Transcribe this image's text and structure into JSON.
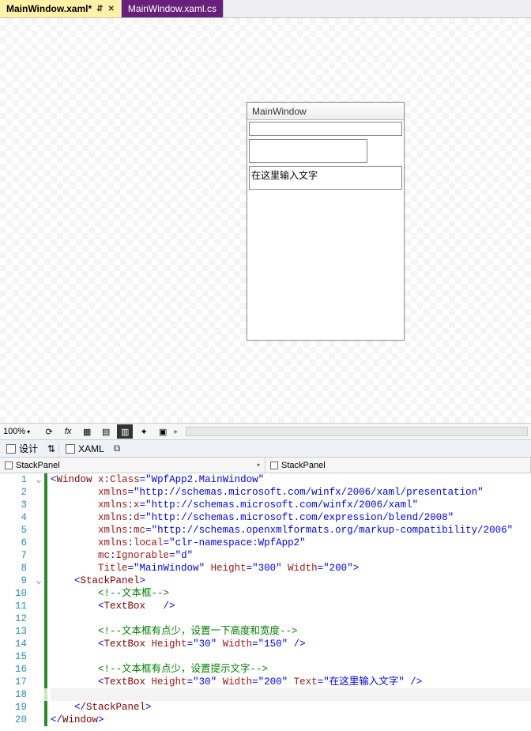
{
  "tabs": {
    "active": {
      "label": "MainWindow.xaml*"
    },
    "inactive": {
      "label": "MainWindow.xaml.cs"
    }
  },
  "preview": {
    "title": "MainWindow",
    "textbox3_text": "在这里输入文字"
  },
  "zoomrow": {
    "zoom_label": "100%",
    "fx": "fx"
  },
  "navrow": {
    "design_label": "设计",
    "xaml_label": "XAML"
  },
  "crumbs": {
    "left": "StackPanel",
    "right": "StackPanel"
  },
  "code": {
    "lines": [
      {
        "n": "1",
        "fold": "v",
        "bar": "bar",
        "seg": [
          [
            "c-blue",
            "<"
          ],
          [
            "c-brown",
            "Window "
          ],
          [
            "c-red",
            "x"
          ],
          [
            "c-blue",
            ":"
          ],
          [
            "c-red",
            "Class"
          ],
          [
            "c-blue",
            "=\""
          ],
          [
            "c-blue",
            "WpfApp2.MainWindow"
          ],
          [
            "c-blue",
            "\""
          ]
        ]
      },
      {
        "n": "2",
        "fold": "",
        "bar": "bar",
        "seg": [
          [
            "sp",
            "        "
          ],
          [
            "c-red",
            "xmlns"
          ],
          [
            "c-blue",
            "=\""
          ],
          [
            "c-blue",
            "http://schemas.microsoft.com/winfx/2006/xaml/presentation"
          ],
          [
            "c-blue",
            "\""
          ]
        ]
      },
      {
        "n": "3",
        "fold": "",
        "bar": "bar",
        "seg": [
          [
            "sp",
            "        "
          ],
          [
            "c-red",
            "xmlns"
          ],
          [
            "c-blue",
            ":"
          ],
          [
            "c-red",
            "x"
          ],
          [
            "c-blue",
            "=\""
          ],
          [
            "c-blue",
            "http://schemas.microsoft.com/winfx/2006/xaml"
          ],
          [
            "c-blue",
            "\""
          ]
        ]
      },
      {
        "n": "4",
        "fold": "",
        "bar": "bar",
        "seg": [
          [
            "sp",
            "        "
          ],
          [
            "c-red",
            "xmlns"
          ],
          [
            "c-blue",
            ":"
          ],
          [
            "c-red",
            "d"
          ],
          [
            "c-blue",
            "=\""
          ],
          [
            "c-blue",
            "http://schemas.microsoft.com/expression/blend/2008"
          ],
          [
            "c-blue",
            "\""
          ]
        ]
      },
      {
        "n": "5",
        "fold": "",
        "bar": "bar",
        "seg": [
          [
            "sp",
            "        "
          ],
          [
            "c-red",
            "xmlns"
          ],
          [
            "c-blue",
            ":"
          ],
          [
            "c-red",
            "mc"
          ],
          [
            "c-blue",
            "=\""
          ],
          [
            "c-blue",
            "http://schemas.openxmlformats.org/markup-compatibility/2006"
          ],
          [
            "c-blue",
            "\""
          ]
        ]
      },
      {
        "n": "6",
        "fold": "",
        "bar": "bar",
        "seg": [
          [
            "sp",
            "        "
          ],
          [
            "c-red",
            "xmlns"
          ],
          [
            "c-blue",
            ":"
          ],
          [
            "c-red",
            "local"
          ],
          [
            "c-blue",
            "=\""
          ],
          [
            "c-blue",
            "clr-namespace:WpfApp2"
          ],
          [
            "c-blue",
            "\""
          ]
        ]
      },
      {
        "n": "7",
        "fold": "",
        "bar": "bar",
        "seg": [
          [
            "sp",
            "        "
          ],
          [
            "c-red",
            "mc"
          ],
          [
            "c-blue",
            ":"
          ],
          [
            "c-red",
            "Ignorable"
          ],
          [
            "c-blue",
            "=\""
          ],
          [
            "c-blue",
            "d"
          ],
          [
            "c-blue",
            "\""
          ]
        ]
      },
      {
        "n": "8",
        "fold": "",
        "bar": "bar",
        "seg": [
          [
            "sp",
            "        "
          ],
          [
            "c-red",
            "Title"
          ],
          [
            "c-blue",
            "=\""
          ],
          [
            "c-blue",
            "MainWindow"
          ],
          [
            "c-blue",
            "\" "
          ],
          [
            "c-red",
            "Height"
          ],
          [
            "c-blue",
            "=\""
          ],
          [
            "c-blue",
            "300"
          ],
          [
            "c-blue",
            "\" "
          ],
          [
            "c-red",
            "Width"
          ],
          [
            "c-blue",
            "=\""
          ],
          [
            "c-blue",
            "200"
          ],
          [
            "c-blue",
            "\">"
          ]
        ]
      },
      {
        "n": "9",
        "fold": "v",
        "bar": "bar",
        "seg": [
          [
            "sp",
            "    "
          ],
          [
            "c-blue",
            "<"
          ],
          [
            "c-brown",
            "StackPanel"
          ],
          [
            "c-blue",
            ">"
          ]
        ]
      },
      {
        "n": "10",
        "fold": "",
        "bar": "bar",
        "seg": [
          [
            "sp",
            "        "
          ],
          [
            "c-green",
            "<!--文本框-->"
          ]
        ]
      },
      {
        "n": "11",
        "fold": "",
        "bar": "bar",
        "seg": [
          [
            "sp",
            "        "
          ],
          [
            "c-blue",
            "<"
          ],
          [
            "c-brown",
            "TextBox   "
          ],
          [
            "c-blue",
            "/>"
          ]
        ]
      },
      {
        "n": "12",
        "fold": "",
        "bar": "bar",
        "seg": [
          [
            "sp",
            ""
          ]
        ]
      },
      {
        "n": "13",
        "fold": "",
        "bar": "bar",
        "seg": [
          [
            "sp",
            "        "
          ],
          [
            "c-green",
            "<!--文本框有点少，设置一下高度和宽度-->"
          ]
        ]
      },
      {
        "n": "14",
        "fold": "",
        "bar": "bar",
        "seg": [
          [
            "sp",
            "        "
          ],
          [
            "c-blue",
            "<"
          ],
          [
            "c-brown",
            "TextBox "
          ],
          [
            "c-red",
            "Height"
          ],
          [
            "c-blue",
            "=\""
          ],
          [
            "c-blue",
            "30"
          ],
          [
            "c-blue",
            "\" "
          ],
          [
            "c-red",
            "Width"
          ],
          [
            "c-blue",
            "=\""
          ],
          [
            "c-blue",
            "150"
          ],
          [
            "c-blue",
            "\" />"
          ]
        ]
      },
      {
        "n": "15",
        "fold": "",
        "bar": "bar",
        "seg": [
          [
            "sp",
            ""
          ]
        ]
      },
      {
        "n": "16",
        "fold": "",
        "bar": "bar",
        "seg": [
          [
            "sp",
            "        "
          ],
          [
            "c-green",
            "<!--文本框有点少，设置提示文字-->"
          ]
        ]
      },
      {
        "n": "17",
        "fold": "",
        "bar": "bar",
        "seg": [
          [
            "sp",
            "        "
          ],
          [
            "c-blue",
            "<"
          ],
          [
            "c-brown",
            "TextBox "
          ],
          [
            "c-red",
            "Height"
          ],
          [
            "c-blue",
            "=\""
          ],
          [
            "c-blue",
            "30"
          ],
          [
            "c-blue",
            "\" "
          ],
          [
            "c-red",
            "Width"
          ],
          [
            "c-blue",
            "=\""
          ],
          [
            "c-blue",
            "200"
          ],
          [
            "c-blue",
            "\" "
          ],
          [
            "c-red",
            "Text"
          ],
          [
            "c-blue",
            "=\""
          ],
          [
            "c-blue",
            "在这里输入文字"
          ],
          [
            "c-blue",
            "\" />"
          ]
        ]
      },
      {
        "n": "18",
        "fold": "",
        "bar": "light",
        "seg": [
          [
            "sp",
            ""
          ]
        ],
        "current": true
      },
      {
        "n": "19",
        "fold": "",
        "bar": "bar",
        "seg": [
          [
            "sp",
            "    "
          ],
          [
            "c-blue",
            "</"
          ],
          [
            "c-brown",
            "StackPanel"
          ],
          [
            "c-blue",
            ">"
          ]
        ]
      },
      {
        "n": "20",
        "fold": "",
        "bar": "bar",
        "seg": [
          [
            "c-blue",
            "</"
          ],
          [
            "c-brown",
            "Window"
          ],
          [
            "c-blue",
            ">"
          ]
        ]
      }
    ]
  }
}
